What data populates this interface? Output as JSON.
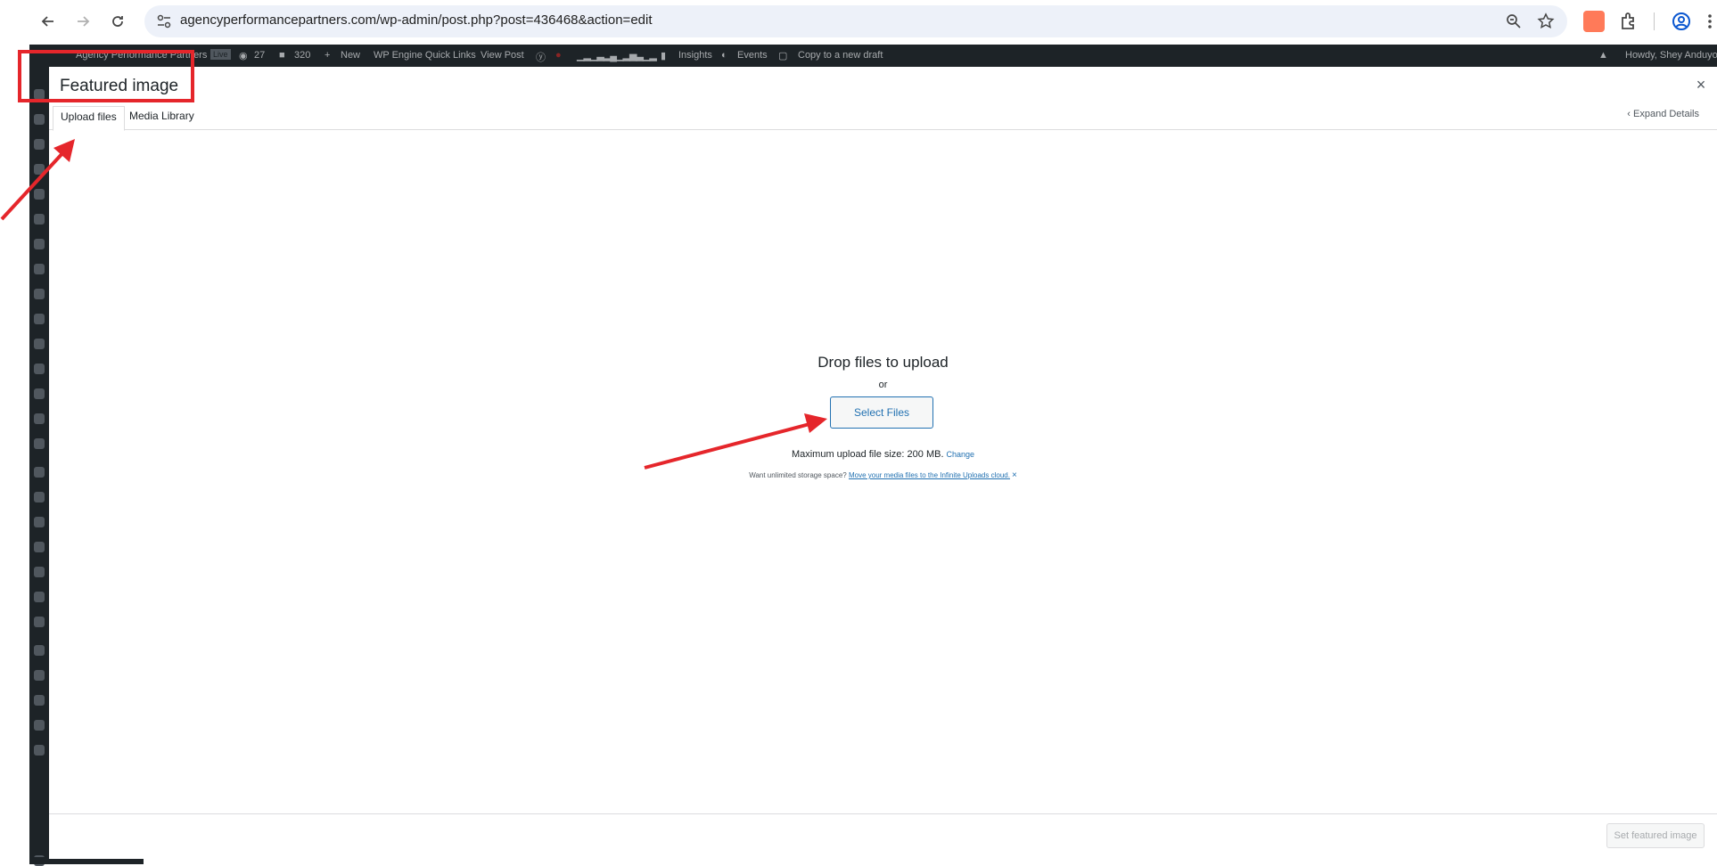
{
  "browser": {
    "url": "agencyperformancepartners.com/wp-admin/post.php?post=436468&action=edit"
  },
  "admin_bar": {
    "site_name": "Agency Performance Partners",
    "live_badge": "Live",
    "views_count": "27",
    "comments_count": "320",
    "new_label": "New",
    "wpengine_label": "WP Engine Quick Links",
    "view_post_label": "View Post",
    "insights_label": "Insights",
    "events_label": "Events",
    "copy_label": "Copy to a new draft",
    "howdy_label": "Howdy, Shey Anduyo"
  },
  "modal": {
    "title": "Featured image",
    "close_label": "×",
    "tabs": [
      {
        "label": "Upload files",
        "active": true
      },
      {
        "label": "Media Library",
        "active": false
      }
    ],
    "expand_details": "Expand Details",
    "drop_title": "Drop files to upload",
    "or_label": "or",
    "select_files_label": "Select Files",
    "max_size_text": "Maximum upload file size: 200 MB.",
    "change_link": "Change",
    "storage_prefix": "Want unlimited storage space?",
    "storage_link": "Move your media files to the Infinite Uploads cloud.",
    "storage_dismiss": "×",
    "set_featured_label": "Set featured image"
  },
  "colors": {
    "annotation": "#e5262b",
    "wp_blue": "#2271b1",
    "admin_bar_bg": "#1d2327"
  }
}
